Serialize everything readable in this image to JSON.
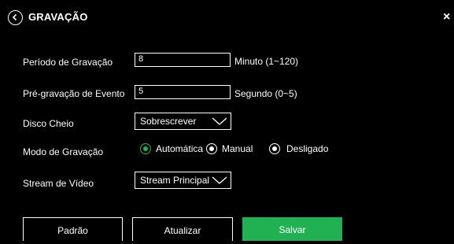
{
  "header": {
    "title": "GRAVAÇÃO",
    "close_label": "×"
  },
  "form": {
    "period": {
      "label": "Período de Gravação",
      "value": "8",
      "unit": "Minuto (1~120)"
    },
    "prerecord": {
      "label": "Pré-gravação de Evento",
      "value": "5",
      "unit": "Segundo (0~5)"
    },
    "disk_full": {
      "label": "Disco Cheio",
      "selected": "Sobrescrever"
    },
    "record_mode": {
      "label": "Modo de Gravação",
      "options": [
        {
          "label": "Automática",
          "selected": true
        },
        {
          "label": "Manual",
          "selected": false
        },
        {
          "label": "Desligado",
          "selected": false
        }
      ]
    },
    "stream": {
      "label": "Stream de Vídeo",
      "selected": "Stream Principal"
    }
  },
  "footer": {
    "default_label": "Padrão",
    "refresh_label": "Atualizar",
    "save_label": "Salvar"
  },
  "colors": {
    "accent": "#21b153",
    "background": "#000000",
    "text": "#ffffff"
  },
  "icons": {
    "back": "chevron-left-circle-icon",
    "close": "close-icon",
    "dropdown": "chevron-down-icon"
  }
}
